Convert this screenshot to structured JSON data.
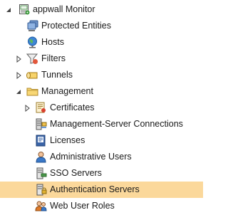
{
  "tree": {
    "root": {
      "label": "appwall Monitor",
      "icon": "monitor-gear-icon",
      "expanded": true
    },
    "items": [
      {
        "label": "Protected Entities",
        "icon": "protected-entities-icon"
      },
      {
        "label": "Hosts",
        "icon": "globe-icon"
      },
      {
        "label": "Filters",
        "icon": "filter-icon",
        "collapsed": true
      },
      {
        "label": "Tunnels",
        "icon": "tunnel-icon",
        "collapsed": true
      },
      {
        "label": "Management",
        "icon": "folder-icon",
        "expanded": true
      },
      {
        "label": "Certificates",
        "icon": "certificate-icon",
        "collapsed": true
      },
      {
        "label": "Management-Server Connections",
        "icon": "server-connections-icon"
      },
      {
        "label": "Licenses",
        "icon": "license-icon"
      },
      {
        "label": "Administrative Users",
        "icon": "admin-user-icon"
      },
      {
        "label": "SSO Servers",
        "icon": "sso-server-icon"
      },
      {
        "label": "Authentication Servers",
        "icon": "auth-server-icon",
        "selected": true
      },
      {
        "label": "Web User Roles",
        "icon": "web-user-roles-icon"
      }
    ]
  },
  "colors": {
    "selection": "#fbd89b",
    "expander": "#444444"
  }
}
